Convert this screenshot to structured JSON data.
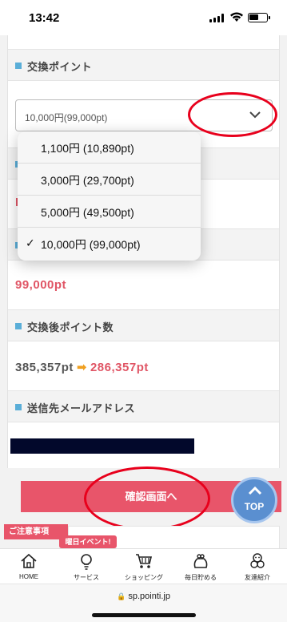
{
  "status_bar": {
    "time": "13:42"
  },
  "form": {
    "exchange_points": {
      "label": "交換ポイント",
      "selected_value": "10,000円(99,000pt)",
      "options": [
        {
          "label": "1,100円 (10,890pt)",
          "selected": false
        },
        {
          "label": "3,000円 (29,700pt)",
          "selected": false
        },
        {
          "label": "5,000円 (49,500pt)",
          "selected": false
        },
        {
          "label": "10,000円 (99,000pt)",
          "selected": true
        }
      ]
    },
    "points_used_value": "99,000pt",
    "points_after": {
      "label": "交換後ポイント数",
      "from": "385,357pt",
      "arrow": "➡",
      "to": "286,357pt"
    },
    "email": {
      "label": "送信先メールアドレス"
    }
  },
  "confirm_button": "確認画面へ",
  "top_button": "TOP",
  "notice": {
    "label": "ご注意事項"
  },
  "event_tag": "曜日イベント!",
  "bottom_nav": [
    {
      "label": "HOME",
      "icon": "home-icon"
    },
    {
      "label": "サービス",
      "icon": "lightbulb-icon"
    },
    {
      "label": "ショッピング",
      "icon": "cart-icon"
    },
    {
      "label": "毎日貯める",
      "icon": "purse-icon"
    },
    {
      "label": "友達紹介",
      "icon": "friends-icon"
    }
  ],
  "address_bar": {
    "lock": "🔒",
    "url": "sp.pointi.jp"
  },
  "colors": {
    "accent": "#e8556a",
    "section_marker": "#5aaed8",
    "annotation": "#e8001c"
  }
}
